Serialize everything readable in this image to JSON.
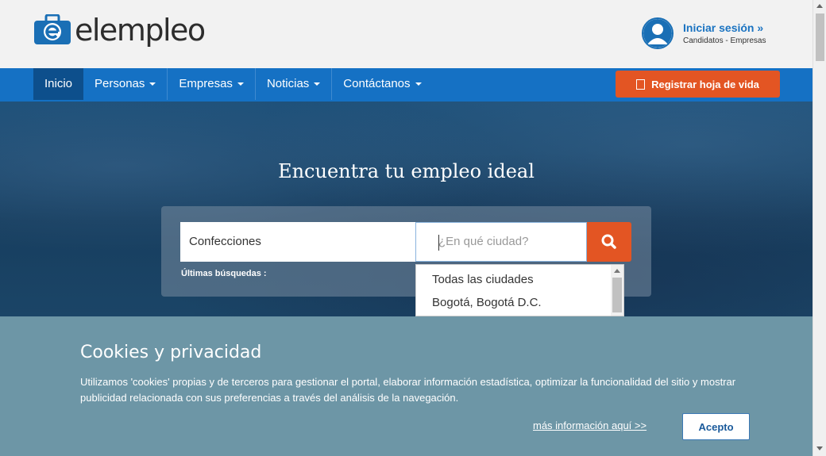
{
  "header": {
    "logo_text": "elempleo",
    "login_title": "Iniciar sesión »",
    "login_subtitle": "Candidatos - Empresas"
  },
  "nav": {
    "items": [
      {
        "label": "Inicio",
        "active": true
      },
      {
        "label": "Personas",
        "dropdown": true
      },
      {
        "label": "Empresas",
        "dropdown": true
      },
      {
        "label": "Noticias",
        "dropdown": true
      },
      {
        "label": "Contáctanos",
        "dropdown": true
      }
    ],
    "register_label": "Registrar hoja de vida"
  },
  "hero": {
    "title": "Encuentra tu empleo ideal",
    "keyword_value": "Confecciones",
    "city_placeholder": "¿En qué ciudad?",
    "recent_label": "Últimas búsquedas :"
  },
  "city_dropdown": {
    "options": [
      "Todas las ciudades",
      "Bogotá, Bogotá D.C."
    ]
  },
  "cookies": {
    "title": "Cookies y privacidad",
    "text": "Utilizamos 'cookies' propias y de terceros para gestionar el portal, elaborar información estadística, optimizar la funcionalidad del sitio y mostrar publicidad relacionada con sus preferencias a través del análisis de la navegación.",
    "more_link": "más información aquí >>",
    "accept_label": "Acepto"
  },
  "colors": {
    "brand_blue": "#1571c4",
    "accent_orange": "#e35523",
    "cookie_banner": "#6d96a6"
  }
}
